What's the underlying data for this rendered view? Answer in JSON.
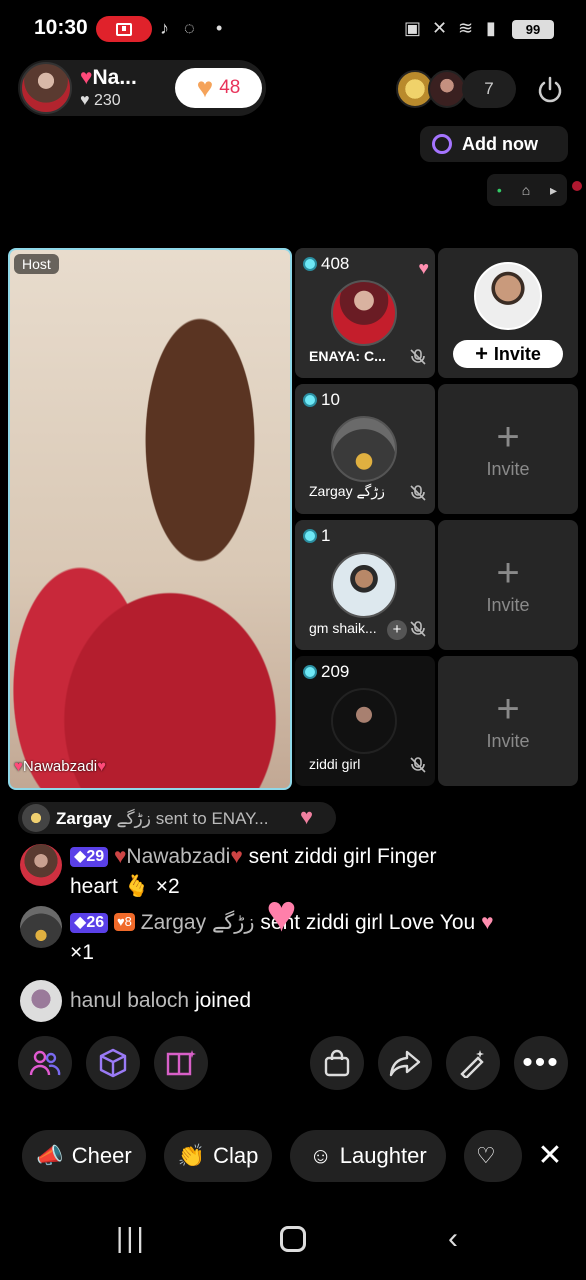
{
  "status_bar": {
    "time": "10:30",
    "battery": "99"
  },
  "header": {
    "host_name": "Na...",
    "host_likes": "230",
    "gift_count": "48",
    "viewer_count": "7",
    "add_now_label": "Add now"
  },
  "host_video": {
    "tag": "Host",
    "name": "Nawabzadi"
  },
  "guests": [
    {
      "count": "408",
      "name": "ENAYA: C..."
    },
    {
      "count": "10",
      "name": "Zargay زڑگے"
    },
    {
      "count": "1",
      "name": "gm shaik..."
    },
    {
      "count": "209",
      "name": "ziddi girl"
    }
  ],
  "invite": {
    "primary_label": "Invite",
    "slot_label": "Invite"
  },
  "gift_banner": {
    "sender": "Zargay",
    "sender_suffix": "زڑگے",
    "text": "sent to ENAY..."
  },
  "chat": [
    {
      "level": "29",
      "user": "Nawabzadi",
      "message": "sent ziddi girl Finger",
      "message_cont": "heart",
      "multiplier": "×2"
    },
    {
      "level": "26",
      "badge": "8",
      "user": "Zargay",
      "user_suffix": "زڑگے",
      "message": "sent ziddi girl Love You",
      "multiplier": "×1"
    },
    {
      "user": "hanul baloch",
      "message": "joined"
    }
  ],
  "reactions": [
    "Cheer",
    "Clap",
    "Laughter"
  ],
  "colors": {
    "accent_cyan": "#6ee8f5",
    "host_border": "#8fd8e8",
    "rec_red": "#e0222b",
    "level_purple": "#5a40e8"
  }
}
